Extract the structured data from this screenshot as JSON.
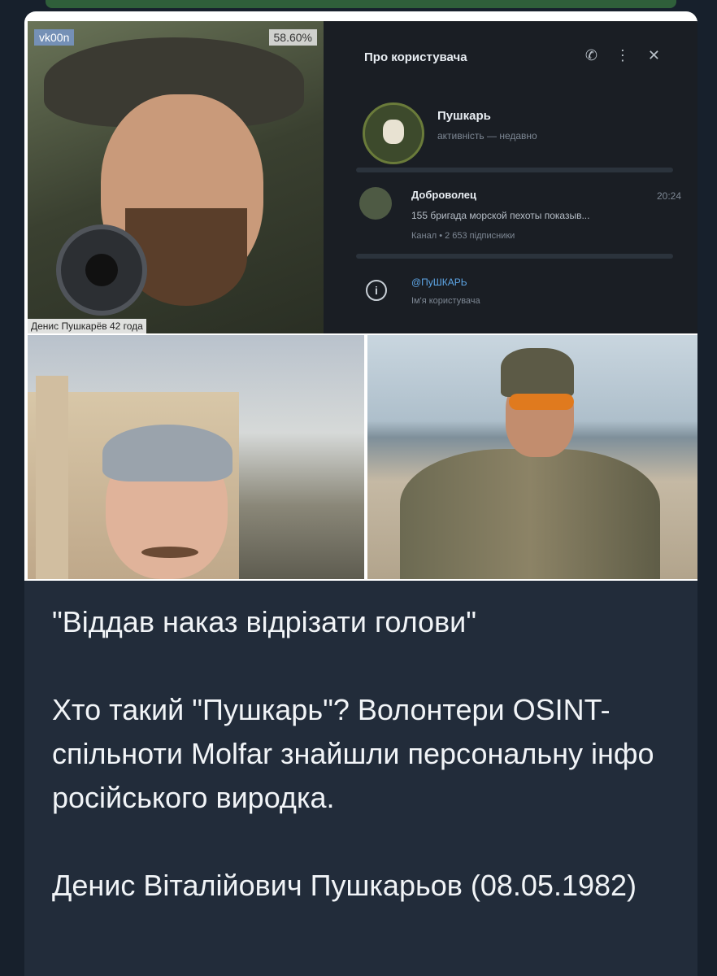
{
  "collage": {
    "photo1": {
      "badge_left": "vk00n",
      "badge_right": "58.60%",
      "caption": "Денис Пушкарёв 42 года"
    },
    "telegram_profile": {
      "title": "Про користувача",
      "icons": [
        "phone-icon",
        "more-icon",
        "close-icon"
      ],
      "name": "Пушкарь",
      "status": "активність — недавно",
      "channel": {
        "name": "Доброволец",
        "time": "20:24",
        "preview": "155 бригада морской пехоты показыв...",
        "subscribers": "Канал • 2 653 підписники"
      },
      "username": "@ПуШКАРЬ",
      "username_label": "Ім'я користувача"
    }
  },
  "message": {
    "headline": "\"Віддав наказ відрізати голови\"",
    "paragraph1": "Хто такий \"Пушкарь\"? Волонтери OSINT-спільноти Molfar знайшли персональну інфо російського виродка.",
    "paragraph2": "Денис Віталійович Пушкарьов (08.05.1982)"
  },
  "colors": {
    "background": "#17202c",
    "bubble": "#222c3a",
    "text": "#f1f4f7",
    "link": "#5ea6e6"
  }
}
